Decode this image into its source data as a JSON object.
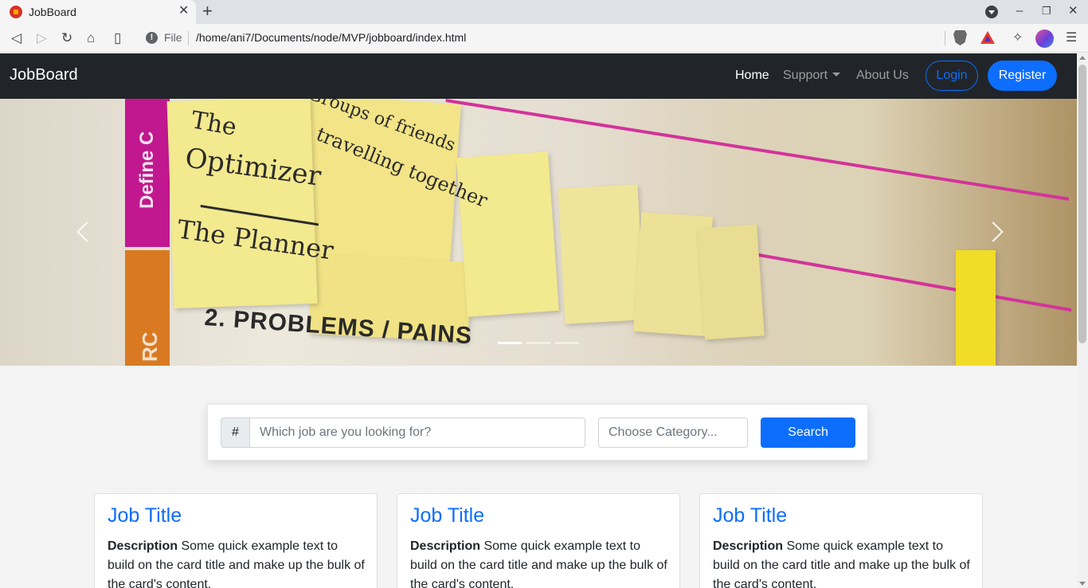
{
  "browser": {
    "tab_title": "JobBoard",
    "tab_close": "✕",
    "new_tab": "+",
    "file_label": "File",
    "url": "/home/ani7/Documents/node/MVP/jobboard/index.html",
    "window_controls": [
      "–",
      "❐",
      "✕"
    ],
    "icons": [
      "back-icon",
      "forward-icon",
      "reload-icon",
      "home-icon",
      "bookmark-icon",
      "info-icon",
      "brave-shield-icon",
      "bat-rewards-icon",
      "extensions-icon",
      "profile-avatar",
      "menu-icon"
    ]
  },
  "navbar": {
    "brand": "JobBoard",
    "links": [
      {
        "label": "Home",
        "active": true
      },
      {
        "label": "Support",
        "dropdown": true
      },
      {
        "label": "About Us"
      }
    ],
    "login": "Login",
    "register": "Register"
  },
  "hero": {
    "slides": 3,
    "active_slide": 1,
    "image_text": {
      "band_top": "Define C",
      "band_bottom": "RC",
      "note_line_1": "The",
      "note_line_2": "Optimizer",
      "note_line_3": "The Planner",
      "note_right_1": "Groups of friends",
      "note_right_2": "travelling together",
      "problems": "2. PROBLEMS / PAINS"
    }
  },
  "search": {
    "prefix": "#",
    "placeholder": "Which job are you looking for?",
    "category_placeholder": "Choose Category...",
    "button": "Search"
  },
  "jobs": [
    {
      "title": "Job Title",
      "desc_label": "Description",
      "desc": " Some quick example text to build on the card title and make up the bulk of the card's content."
    },
    {
      "title": "Job Title",
      "desc_label": "Description",
      "desc": " Some quick example text to build on the card title and make up the bulk of the card's content."
    },
    {
      "title": "Job Title",
      "desc_label": "Description",
      "desc": " Some quick example text to build on the card title and make up the bulk of the card's content."
    }
  ],
  "colors": {
    "primary": "#0d6efd",
    "navbar_bg": "#212529",
    "page_bg": "#f4f4f4"
  }
}
